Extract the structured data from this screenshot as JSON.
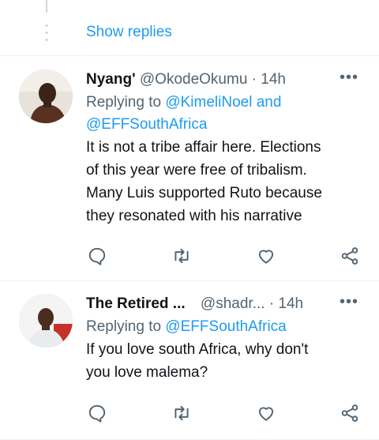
{
  "thread": {
    "show_replies": "Show replies"
  },
  "tweets": [
    {
      "name": "Nyang'",
      "handle": "@OkodeOkumu",
      "time": "· 14h",
      "replying_prefix": "Replying to",
      "replying_to_1": "@KimeliNoel and",
      "replying_to_2": "@EFFSouthAfrica",
      "text_lines": [
        "It is not a tribe affair here. Elections",
        "of this year were free of tribalism.",
        "Many Luis supported Ruto because",
        "they resonated with his narrative"
      ]
    },
    {
      "name": "The Retired ...",
      "handle": "@shadr...",
      "time": "· 14h",
      "replying_prefix": "Replying to",
      "replying_to_1": "@EFFSouthAfrica",
      "text_lines": [
        "If you love south Africa, why don't",
        "you love malema?"
      ]
    }
  ],
  "more_glyph": "•••",
  "icons": [
    "reply-icon",
    "retweet-icon",
    "like-icon",
    "share-icon"
  ],
  "colors": {
    "link": "#1d9bf0",
    "secondary": "#536471",
    "text": "#0f1419"
  }
}
